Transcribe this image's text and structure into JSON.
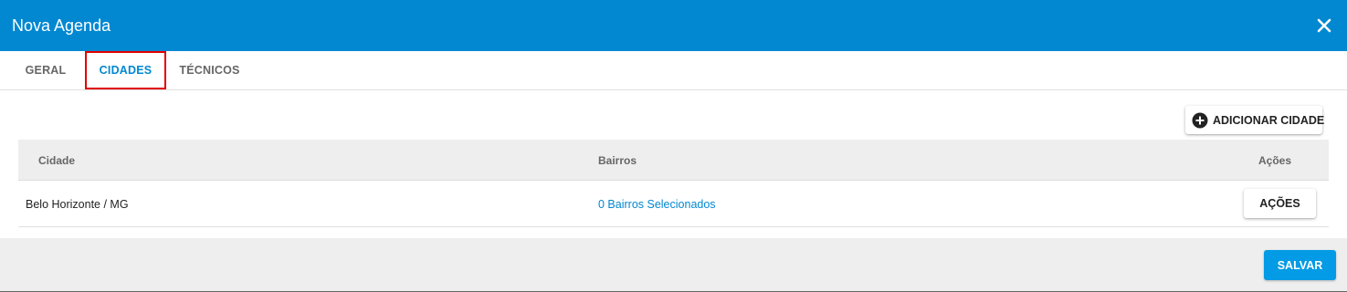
{
  "header": {
    "title": "Nova Agenda",
    "background": "#0288d1"
  },
  "tabs": [
    {
      "label": "GERAL",
      "active": false
    },
    {
      "label": "CIDADES",
      "active": true
    },
    {
      "label": "TÉCNICOS",
      "active": false
    }
  ],
  "toolbar": {
    "add_city_label": "ADICIONAR CIDADE",
    "add_icon": "plus-circle-icon"
  },
  "table": {
    "columns": [
      "Cidade",
      "Bairros",
      "Ações"
    ],
    "rows": [
      {
        "cidade": "Belo Horizonte / MG",
        "bairros": "0 Bairros Selecionados",
        "acoes": "AÇÕES"
      }
    ]
  },
  "footer": {
    "save_label": "SALVAR",
    "save_color": "#039be5"
  },
  "colors": {
    "accent": "#0288d1",
    "highlight_border": "#e00000"
  }
}
